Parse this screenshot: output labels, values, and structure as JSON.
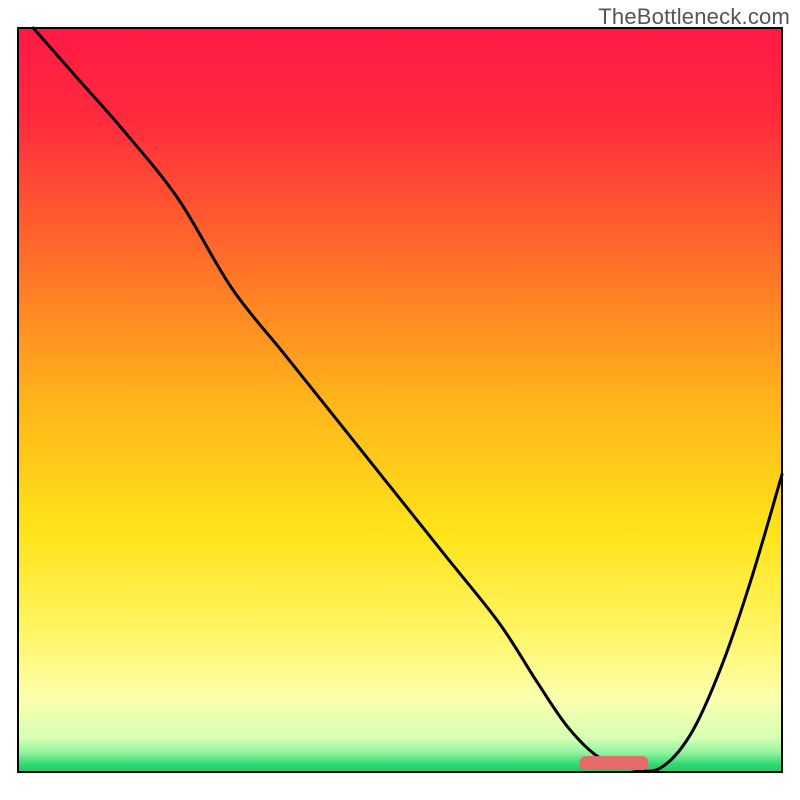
{
  "watermark": "TheBottleneck.com",
  "chart_data": {
    "type": "line",
    "title": "",
    "xlabel": "",
    "ylabel": "",
    "xlim": [
      0,
      100
    ],
    "ylim": [
      0,
      100
    ],
    "grid": false,
    "legend": false,
    "background_gradient_stops": [
      {
        "offset": 0.0,
        "color": "#ff1a44"
      },
      {
        "offset": 0.12,
        "color": "#ff2a3e"
      },
      {
        "offset": 0.3,
        "color": "#ff6a2a"
      },
      {
        "offset": 0.5,
        "color": "#ffb41a"
      },
      {
        "offset": 0.68,
        "color": "#ffe41a"
      },
      {
        "offset": 0.82,
        "color": "#fff66a"
      },
      {
        "offset": 0.9,
        "color": "#fcffad"
      },
      {
        "offset": 0.955,
        "color": "#d6ffb3"
      },
      {
        "offset": 0.975,
        "color": "#8cf29c"
      },
      {
        "offset": 0.99,
        "color": "#2fd872"
      },
      {
        "offset": 1.0,
        "color": "#1fc865"
      }
    ],
    "series": [
      {
        "name": "bottleneck-curve",
        "color": "#000000",
        "x": [
          2,
          8,
          14,
          21,
          28,
          35,
          42,
          49,
          56,
          63,
          68,
          72,
          76,
          80,
          84,
          88,
          92,
          96,
          100
        ],
        "y": [
          100,
          93,
          86,
          77,
          65,
          56,
          47,
          38,
          29,
          20,
          12,
          6,
          2,
          0.5,
          0.5,
          5,
          14,
          26,
          40
        ]
      }
    ],
    "marker": {
      "name": "optimal-range",
      "color": "#e76a6a",
      "x_center": 78,
      "width": 9,
      "y": 1.2
    },
    "annotations": []
  }
}
